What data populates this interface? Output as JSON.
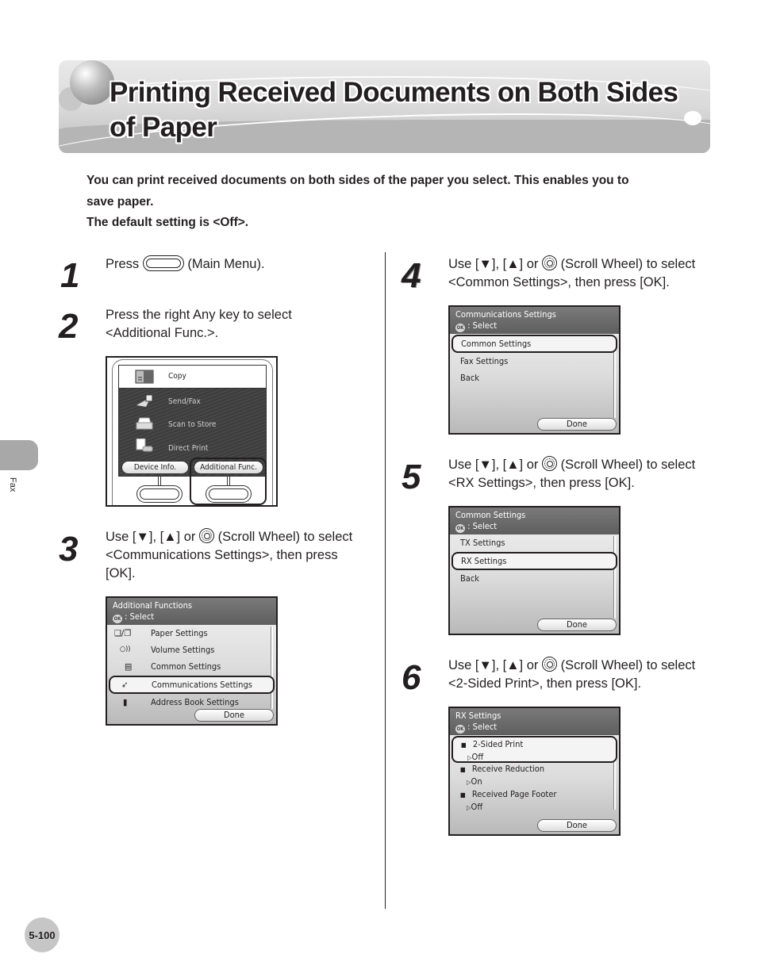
{
  "page": {
    "title_line1": "Printing Received Documents on Both Sides",
    "title_line2": "of Paper",
    "intro_line1": "You can print received documents on both sides of the paper you select. This enables you to",
    "intro_line2": "save paper.",
    "intro_line3": "The default setting is <Off>.",
    "side_tab_label": "Fax",
    "page_number": "5-100"
  },
  "steps": [
    {
      "number": "1",
      "text_before": "Press ",
      "text_after": " (Main Menu).",
      "icon": "main-menu-key-icon"
    },
    {
      "number": "2",
      "line1": "Press the right Any key to select",
      "line2": "<Additional Func.>.",
      "screen": {
        "items": [
          "Copy",
          "Send/Fax",
          "Scan to Store",
          "Direct Print"
        ],
        "left_key": "Device Info.",
        "right_key": "Additional Func.",
        "highlighted": "Additional Func."
      }
    },
    {
      "number": "3",
      "line1_a": "Use [",
      "down": "▼",
      "line1_b": "], [",
      "up": "▲",
      "line1_c": "] or ",
      "line1_d": " (Scroll Wheel) to select",
      "line2": "<Communications Settings>, then press",
      "line3": "[OK].",
      "screen": {
        "title": "Additional Functions",
        "subtitle": ": Select",
        "ok_label": "OK",
        "items": [
          {
            "label": "Paper Settings",
            "icon": "paper-icon"
          },
          {
            "label": "Volume Settings",
            "icon": "volume-icon"
          },
          {
            "label": "Common Settings",
            "icon": "document-icon"
          },
          {
            "label": "Communications Settings",
            "icon": "send-fax-icon"
          },
          {
            "label": "Address Book Settings",
            "icon": "address-book-icon"
          }
        ],
        "selected_index": 3,
        "done": "Done"
      }
    },
    {
      "number": "4",
      "line1_a": "Use [",
      "down": "▼",
      "line1_b": "], [",
      "up": "▲",
      "line1_c": "] or ",
      "line1_d": " (Scroll Wheel) to select",
      "line2": "<Common Settings>, then press [OK].",
      "screen": {
        "title": "Communications Settings",
        "subtitle": ": Select",
        "ok_label": "OK",
        "items": [
          "Common Settings",
          "Fax Settings",
          "Back"
        ],
        "selected_index": 0,
        "done": "Done"
      }
    },
    {
      "number": "5",
      "line1_a": "Use [",
      "down": "▼",
      "line1_b": "], [",
      "up": "▲",
      "line1_c": "] or ",
      "line1_d": " (Scroll Wheel) to select",
      "line2": "<RX Settings>, then press [OK].",
      "screen": {
        "title": "Common Settings",
        "subtitle": ": Select",
        "ok_label": "OK",
        "items": [
          "TX Settings",
          "RX Settings",
          "Back"
        ],
        "selected_index": 1,
        "done": "Done"
      }
    },
    {
      "number": "6",
      "line1_a": "Use [",
      "down": "▼",
      "line1_b": "], [",
      "up": "▲",
      "line1_c": "] or ",
      "line1_d": " (Scroll Wheel) to select",
      "line2": "<2-Sided Print>, then press [OK].",
      "screen": {
        "title": "RX Settings",
        "subtitle": ": Select",
        "ok_label": "OK",
        "items": [
          {
            "label": "2-Sided Print",
            "value": "Off"
          },
          {
            "label": "Receive Reduction",
            "value": "On"
          },
          {
            "label": "Received Page Footer",
            "value": "Off"
          }
        ],
        "selected_index": 0,
        "value_marker": "▷",
        "done": "Done"
      }
    }
  ]
}
